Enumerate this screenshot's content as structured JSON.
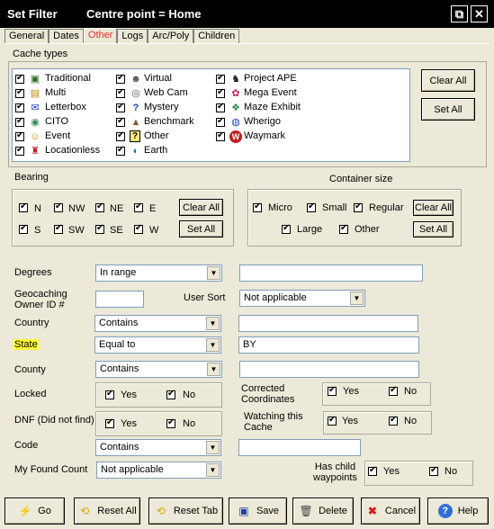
{
  "window": {
    "title": "Set Filter",
    "subtitle": "Centre point = Home",
    "restore_glyph": "⧉",
    "close_glyph": "✕"
  },
  "tabs": [
    "General",
    "Dates",
    "Other",
    "Logs",
    "Arc/Poly",
    "Children"
  ],
  "cache_types": {
    "label": "Cache types",
    "items": [
      {
        "label": "Traditional",
        "icon": "traditional-cache-icon",
        "glyph": "▣"
      },
      {
        "label": "Multi",
        "icon": "multi-cache-icon",
        "glyph": "▤"
      },
      {
        "label": "Letterbox",
        "icon": "letterbox-cache-icon",
        "glyph": "✉"
      },
      {
        "label": "CITO",
        "icon": "cito-cache-icon",
        "glyph": "◉"
      },
      {
        "label": "Event",
        "icon": "event-cache-icon",
        "glyph": "☺"
      },
      {
        "label": "Locationless",
        "icon": "locationless-cache-icon",
        "glyph": "♜"
      },
      {
        "label": "Virtual",
        "icon": "virtual-cache-icon",
        "glyph": "☻"
      },
      {
        "label": "Web Cam",
        "icon": "webcam-cache-icon",
        "glyph": "◎"
      },
      {
        "label": "Mystery",
        "icon": "mystery-cache-icon",
        "glyph": "?"
      },
      {
        "label": "Benchmark",
        "icon": "benchmark-cache-icon",
        "glyph": "▲"
      },
      {
        "label": "Other",
        "icon": "other-cache-icon",
        "glyph": "?"
      },
      {
        "label": "Earth",
        "icon": "earth-cache-icon",
        "glyph": "◐"
      },
      {
        "label": "Project APE",
        "icon": "project-ape-cache-icon",
        "glyph": "♞"
      },
      {
        "label": "Mega Event",
        "icon": "mega-event-cache-icon",
        "glyph": "✿"
      },
      {
        "label": "Maze Exhibit",
        "icon": "maze-exhibit-cache-icon",
        "glyph": "❖"
      },
      {
        "label": "Wherigo",
        "icon": "wherigo-cache-icon",
        "glyph": "◍"
      },
      {
        "label": "Waymark",
        "icon": "waymark-cache-icon",
        "glyph": "W"
      }
    ],
    "clear_all": "Clear All",
    "set_all": "Set All"
  },
  "bearing": {
    "label": "Bearing",
    "items": [
      "N",
      "NW",
      "NE",
      "E",
      "S",
      "SW",
      "SE",
      "W"
    ],
    "clear_all": "Clear All",
    "set_all": "Set All"
  },
  "container": {
    "label": "Container size",
    "items": [
      "Micro",
      "Small",
      "Regular",
      "Large",
      "Other"
    ],
    "clear_all": "Clear All",
    "set_all": "Set All"
  },
  "fields": {
    "degrees": {
      "label": "Degrees",
      "combo": "In range",
      "value": ""
    },
    "owner_id": {
      "label": "Geocaching\nOwner ID #",
      "value": ""
    },
    "user_sort": {
      "label": "User Sort",
      "combo": "Not applicable"
    },
    "country": {
      "label": "Country",
      "combo": "Contains",
      "value": ""
    },
    "state": {
      "label": "State",
      "combo": "Equal to",
      "value": "BY"
    },
    "county": {
      "label": "County",
      "combo": "Contains",
      "value": ""
    },
    "locked": {
      "label": "Locked",
      "yes": "Yes",
      "no": "No"
    },
    "corrected": {
      "label": "Corrected\nCoordinates",
      "yes": "Yes",
      "no": "No"
    },
    "dnf": {
      "label": "DNF (Did not find)",
      "yes": "Yes",
      "no": "No"
    },
    "watching": {
      "label": "Watching this\nCache",
      "yes": "Yes",
      "no": "No"
    },
    "code": {
      "label": "Code",
      "combo": "Contains",
      "value": ""
    },
    "my_found_count": {
      "label": "My Found Count",
      "combo": "Not applicable"
    },
    "has_child": {
      "label": "Has child\nwaypoints",
      "yes": "Yes",
      "no": "No"
    }
  },
  "buttons": {
    "go": "Go",
    "reset_all": "Reset All",
    "reset_tab": "Reset Tab",
    "save": "Save",
    "delete": "Delete",
    "cancel": "Cancel",
    "help": "Help"
  },
  "colors": {
    "title_bar": "#000000",
    "window_bg": "#ece9d8",
    "active_tab": "#e3302d",
    "state_highlight": "#ffff33"
  }
}
